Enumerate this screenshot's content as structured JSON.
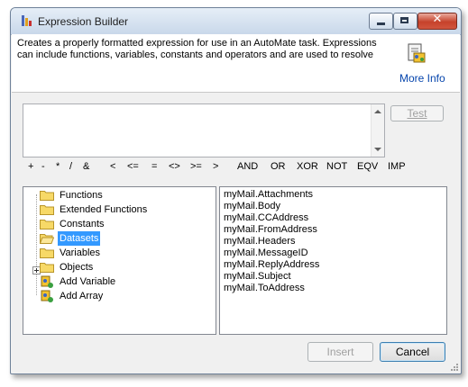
{
  "window": {
    "title": "Expression Builder"
  },
  "header": {
    "description": "Creates a properly formatted expression for use in an AutoMate task.  Expressions can include functions, variables, constants and operators and are used to resolve",
    "more_info": "More Info"
  },
  "expression": {
    "value": "",
    "test_label": "Test"
  },
  "operators": [
    "+",
    "-",
    "*",
    "/",
    "&",
    "<",
    "<=",
    "=",
    "<>",
    ">=",
    ">",
    "AND",
    "OR",
    "XOR",
    "NOT",
    "EQV",
    "IMP"
  ],
  "tree": {
    "items": [
      {
        "label": "Functions",
        "icon": "folder-icon"
      },
      {
        "label": "Extended Functions",
        "icon": "folder-icon"
      },
      {
        "label": "Constants",
        "icon": "folder-icon"
      },
      {
        "label": "Datasets",
        "icon": "open-folder-icon",
        "selected": true
      },
      {
        "label": "Variables",
        "icon": "folder-icon"
      },
      {
        "label": "Objects",
        "icon": "folder-icon",
        "expandable": true
      },
      {
        "label": "Add Variable",
        "icon": "add-variable-icon"
      },
      {
        "label": "Add Array",
        "icon": "add-array-icon"
      }
    ]
  },
  "list": {
    "items": [
      "myMail.Attachments",
      "myMail.Body",
      "myMail.CCAddress",
      "myMail.FromAddress",
      "myMail.Headers",
      "myMail.MessageID",
      "myMail.ReplyAddress",
      "myMail.Subject",
      "myMail.ToAddress"
    ]
  },
  "footer": {
    "insert_label": "Insert",
    "cancel_label": "Cancel"
  },
  "colors": {
    "selection": "#3399ff",
    "link": "#0645ad",
    "close_button": "#c6422b"
  }
}
